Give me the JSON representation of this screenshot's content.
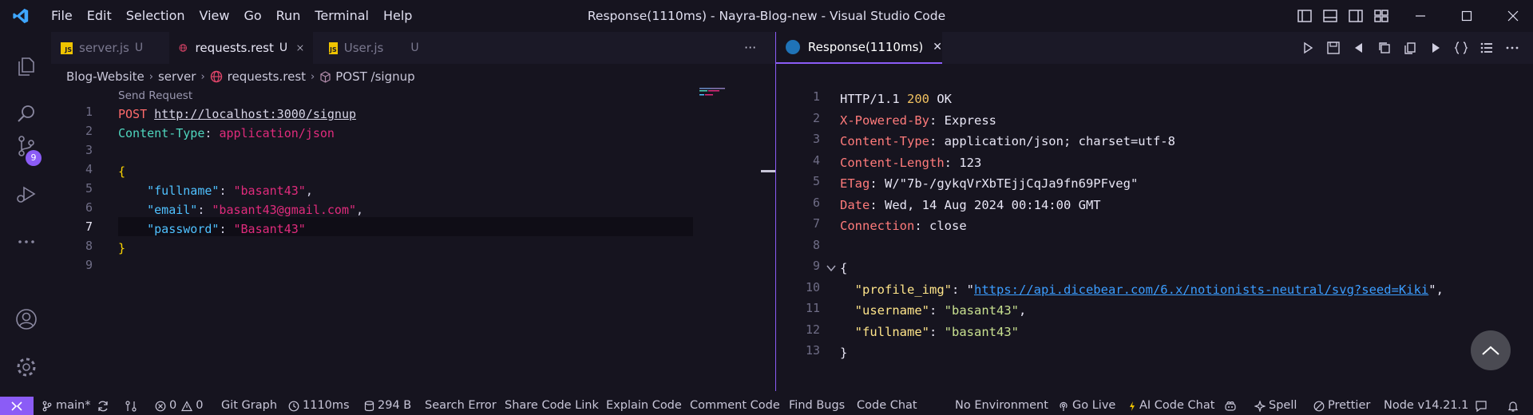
{
  "app": {
    "menu": [
      "File",
      "Edit",
      "Selection",
      "View",
      "Go",
      "Run",
      "Terminal",
      "Help"
    ],
    "window_title": "Response(1110ms) - Nayra-Blog-new - Visual Studio Code"
  },
  "activity_bar": {
    "source_control_badge": "9"
  },
  "tabs_left": [
    {
      "label": "server.js",
      "status": "U",
      "kind": "js"
    },
    {
      "label": "requests.rest",
      "status": "U",
      "kind": "rest"
    },
    {
      "label": "User.js",
      "status": "U",
      "kind": "js"
    }
  ],
  "tabs_overflow": "···",
  "breadcrumb": {
    "project": "Blog-Website",
    "folder": "server",
    "file": "requests.rest",
    "symbol": "POST /signup",
    "separator": "›"
  },
  "codelens": "Send Request",
  "request": {
    "line_numbers": [
      "1",
      "2",
      "3",
      "4",
      "5",
      "6",
      "7",
      "8",
      "9"
    ],
    "method": "POST",
    "url": "http://localhost:3000/signup",
    "header_key": "Content-Type",
    "header_value": "application/json",
    "open_brace": "{",
    "close_brace": "}",
    "fullname_key": "\"fullname\"",
    "fullname_val": "\"basant43\"",
    "email_key": "\"email\"",
    "email_val": "\"basant43@gmail.com\"",
    "password_key": "\"password\"",
    "password_val": "\"Basant43\""
  },
  "response_tab": {
    "label": "Response(1110ms)",
    "close": "✕"
  },
  "response": {
    "line_numbers": [
      "1",
      "2",
      "3",
      "4",
      "5",
      "6",
      "7",
      "8",
      "9",
      "10",
      "11",
      "12",
      "13"
    ],
    "status_proto": "HTTP/1.1",
    "status_code": "200",
    "status_text": "OK",
    "headers": [
      {
        "key": "X-Powered-By",
        "value": "Express"
      },
      {
        "key": "Content-Type",
        "value": "application/json; charset=utf-8"
      },
      {
        "key": "Content-Length",
        "value": "123"
      },
      {
        "key": "ETag",
        "value": "W/\"7b-/gykqVrXbTEjjCqJa9fn69PFveg\""
      },
      {
        "key": "Date",
        "value": "Wed, 14 Aug 2024 00:14:00 GMT"
      },
      {
        "key": "Connection",
        "value": "close"
      }
    ],
    "open_brace": "{",
    "close_brace": "}",
    "profile_img_key": "\"profile_img\"",
    "profile_img_val": "https://api.dicebear.com/6.x/notionists-neutral/svg?seed=Kiki",
    "username_key": "\"username\"",
    "username_val": "\"basant43\"",
    "fullname_key": "\"fullname\"",
    "fullname_val": "\"basant43\""
  },
  "statusbar": {
    "branch": "main*",
    "errors": "0",
    "warnings": "0",
    "git_graph": "Git Graph",
    "duration": "1110ms",
    "size": "294 B",
    "search_error": "Search Error",
    "share_code_link": "Share Code Link",
    "explain_code": "Explain Code",
    "comment_code": "Comment Code",
    "find_bugs": "Find Bugs",
    "code_chat": "Code Chat",
    "no_environment": "No Environment",
    "go_live": "Go Live",
    "ai_code_chat": "AI Code Chat",
    "spell": "Spell",
    "prettier": "Prettier",
    "node": "Node v14.21.1"
  },
  "colors": {
    "accent": "#8b5cf6",
    "background": "#16141f",
    "tab_bar": "#1b1927"
  }
}
